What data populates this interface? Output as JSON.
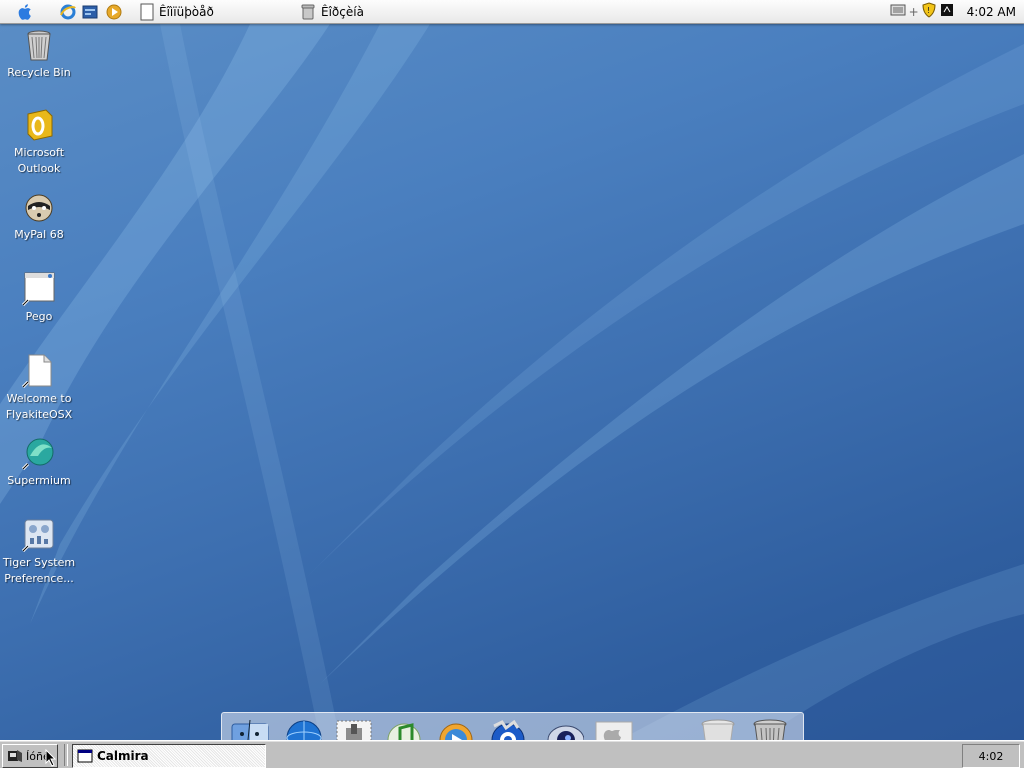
{
  "menubar": {
    "menu1_label": "Êîìïüþòåð",
    "menu2_label": "Êîðçèíà",
    "clock": "4:02 AM"
  },
  "desktop_icons": [
    {
      "label": "Recycle Bin",
      "icon": "recycle-bin-icon"
    },
    {
      "label": "Microsoft Outlook",
      "icon": "outlook-icon"
    },
    {
      "label": "MyPal 68",
      "icon": "mypal-icon"
    },
    {
      "label": "Pego",
      "icon": "pego-icon"
    },
    {
      "label": "Welcome to FlyakiteOSX",
      "icon": "document-icon"
    },
    {
      "label": "Supermium",
      "icon": "supermium-icon"
    },
    {
      "label": "Tiger System Preference...",
      "icon": "system-preferences-icon"
    }
  ],
  "dock_items": [
    "finder-icon",
    "browser-icon",
    "mail-icon",
    "itunes-icon",
    "media-player-icon",
    "quicktime-icon",
    "sherlock-icon",
    "system-prefs-icon",
    "trash-icon"
  ],
  "taskbar": {
    "start_label": "Íóñê",
    "task_label": "Calmira",
    "clock": "4:02"
  },
  "colors": {
    "wallpaper_top": "#5b8ec6",
    "wallpaper_bottom": "#2a5597",
    "taskbar_gray": "#c0c0c0"
  }
}
